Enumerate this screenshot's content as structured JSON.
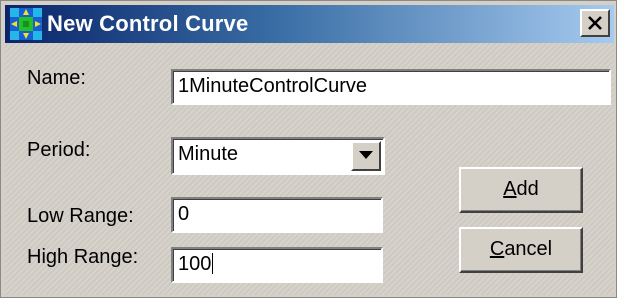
{
  "window": {
    "title": "New Control Curve",
    "close_label": "×"
  },
  "form": {
    "name_label": "Name:",
    "name_value": "1MinuteControlCurve",
    "period_label": "Period:",
    "period_value": "Minute",
    "low_range_label": "Low Range:",
    "low_range_value": "0",
    "high_range_label": "High Range:",
    "high_range_value": "100"
  },
  "buttons": {
    "add_mnemonic": "A",
    "add_rest": "dd",
    "cancel_mnemonic": "C",
    "cancel_rest": "ancel"
  },
  "icons": {
    "title_icon": "control-curve-app-icon",
    "close_icon": "close-icon",
    "dropdown_icon": "chevron-down-icon"
  },
  "colors": {
    "titlebar_start": "#0a246a",
    "titlebar_end": "#a6caf0",
    "dialog_face": "#d4d0c8"
  }
}
